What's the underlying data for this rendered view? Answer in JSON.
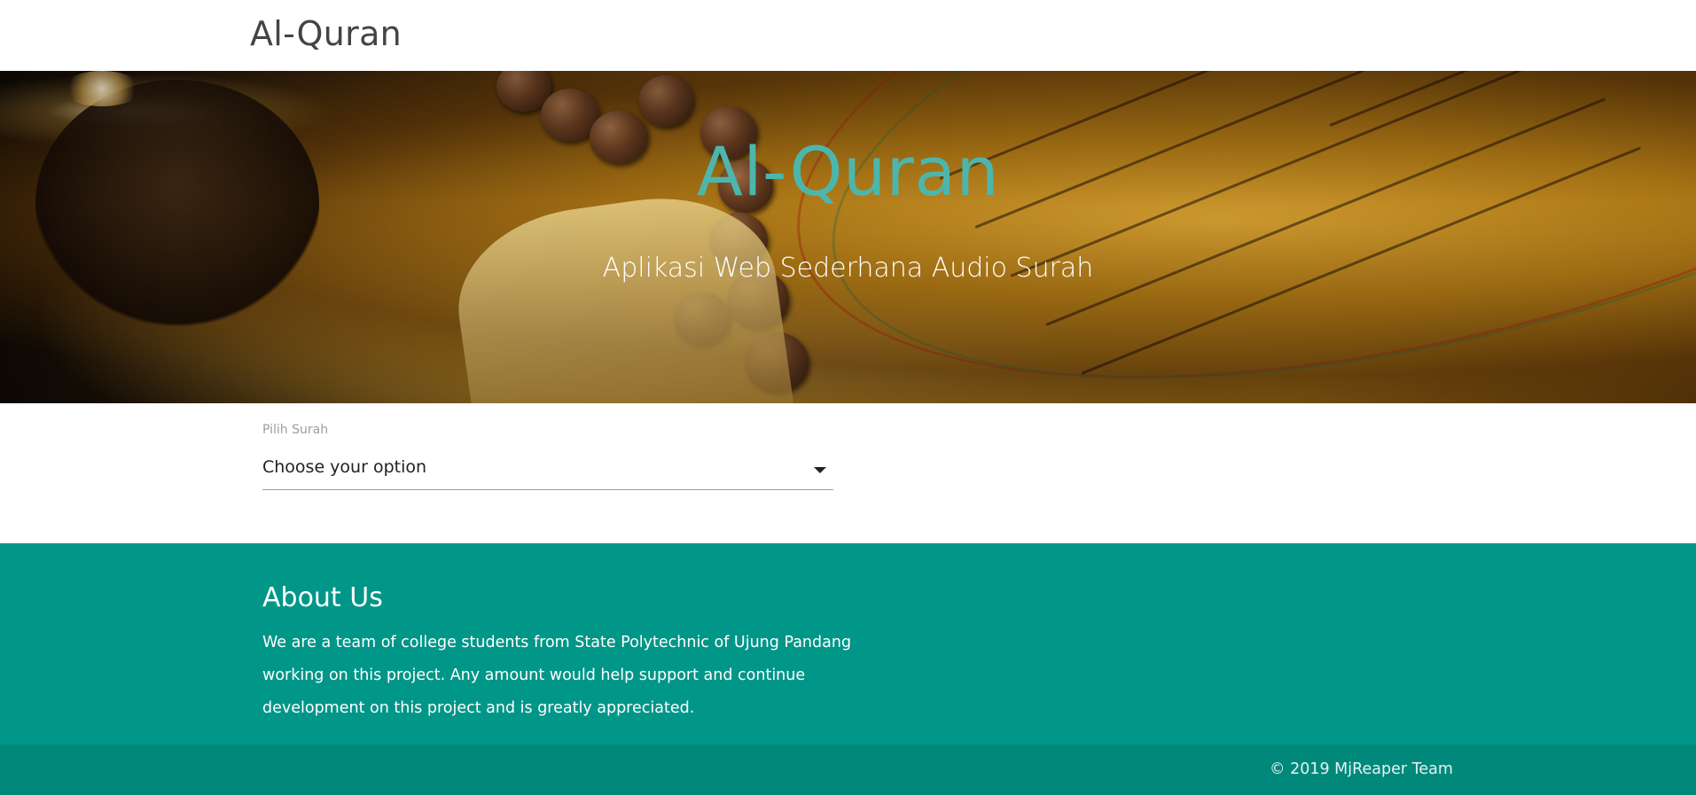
{
  "navbar": {
    "brand": "Al-Quran"
  },
  "hero": {
    "title": "Al-Quran",
    "subtitle": "Aplikasi Web Sederhana Audio Surah"
  },
  "select": {
    "label": "Pilih Surah",
    "value": "Choose your option"
  },
  "about": {
    "title": "About Us",
    "text": "We are a team of college students from State Polytechnic of Ujung Pandang working on this project. Any amount would help support and continue development on this project and is greatly appreciated."
  },
  "footer": {
    "copyright": "© 2019 MjReaper Team"
  },
  "colors": {
    "accent_teal": "#4db6ac",
    "footer_bg": "#009688",
    "footer_bottom_bg": "#00897b"
  }
}
